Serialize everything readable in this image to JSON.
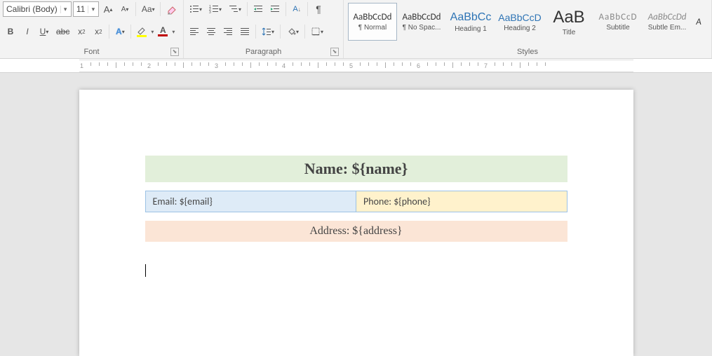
{
  "ribbon": {
    "font": {
      "name": "Calibri (Body)",
      "size": "11",
      "group": "Font"
    },
    "paragraph": {
      "group": "Paragraph"
    },
    "styles": {
      "group": "Styles",
      "items": [
        {
          "sample": "AaBbCcDd",
          "name": "¶ Normal",
          "selected": true,
          "sampleFont": "'Calibri',sans-serif",
          "sampleSize": "13px",
          "sampleColor": "#333"
        },
        {
          "sample": "AaBbCcDd",
          "name": "¶ No Spac...",
          "sampleFont": "'Calibri',sans-serif",
          "sampleSize": "13px",
          "sampleColor": "#333"
        },
        {
          "sample": "AaBbCc",
          "name": "Heading 1",
          "sampleFont": "'Calibri Light',sans-serif",
          "sampleSize": "16px",
          "sampleColor": "#2e74b5"
        },
        {
          "sample": "AaBbCcD",
          "name": "Heading 2",
          "sampleFont": "'Calibri Light',sans-serif",
          "sampleSize": "14px",
          "sampleColor": "#2e74b5"
        },
        {
          "sample": "AaB",
          "name": "Title",
          "sampleFont": "'Calibri Light',sans-serif",
          "sampleSize": "24px",
          "sampleColor": "#333"
        },
        {
          "sample": "AaBbCcD",
          "name": "Subtitle",
          "sampleFont": "'Calibri',sans-serif",
          "sampleSize": "13px",
          "sampleColor": "#888",
          "letterSpacing": "1px"
        },
        {
          "sample": "AaBbCcDd",
          "name": "Subtle Em...",
          "sampleFont": "'Calibri',sans-serif",
          "sampleSize": "13px",
          "sampleColor": "#888",
          "italic": true
        },
        {
          "sample": "A",
          "name": "",
          "sampleFont": "'Calibri',sans-serif",
          "sampleSize": "13px",
          "sampleColor": "#333",
          "italic": true,
          "cut": true
        }
      ]
    }
  },
  "document": {
    "name_field": "Name: ${name}",
    "email_field": "Email: ${email}",
    "phone_field": "Phone: ${phone}",
    "address_field": "Address: ${address}"
  },
  "ruler": {
    "marks": [
      "1",
      "2",
      "3",
      "4",
      "5",
      "6",
      "7"
    ]
  }
}
